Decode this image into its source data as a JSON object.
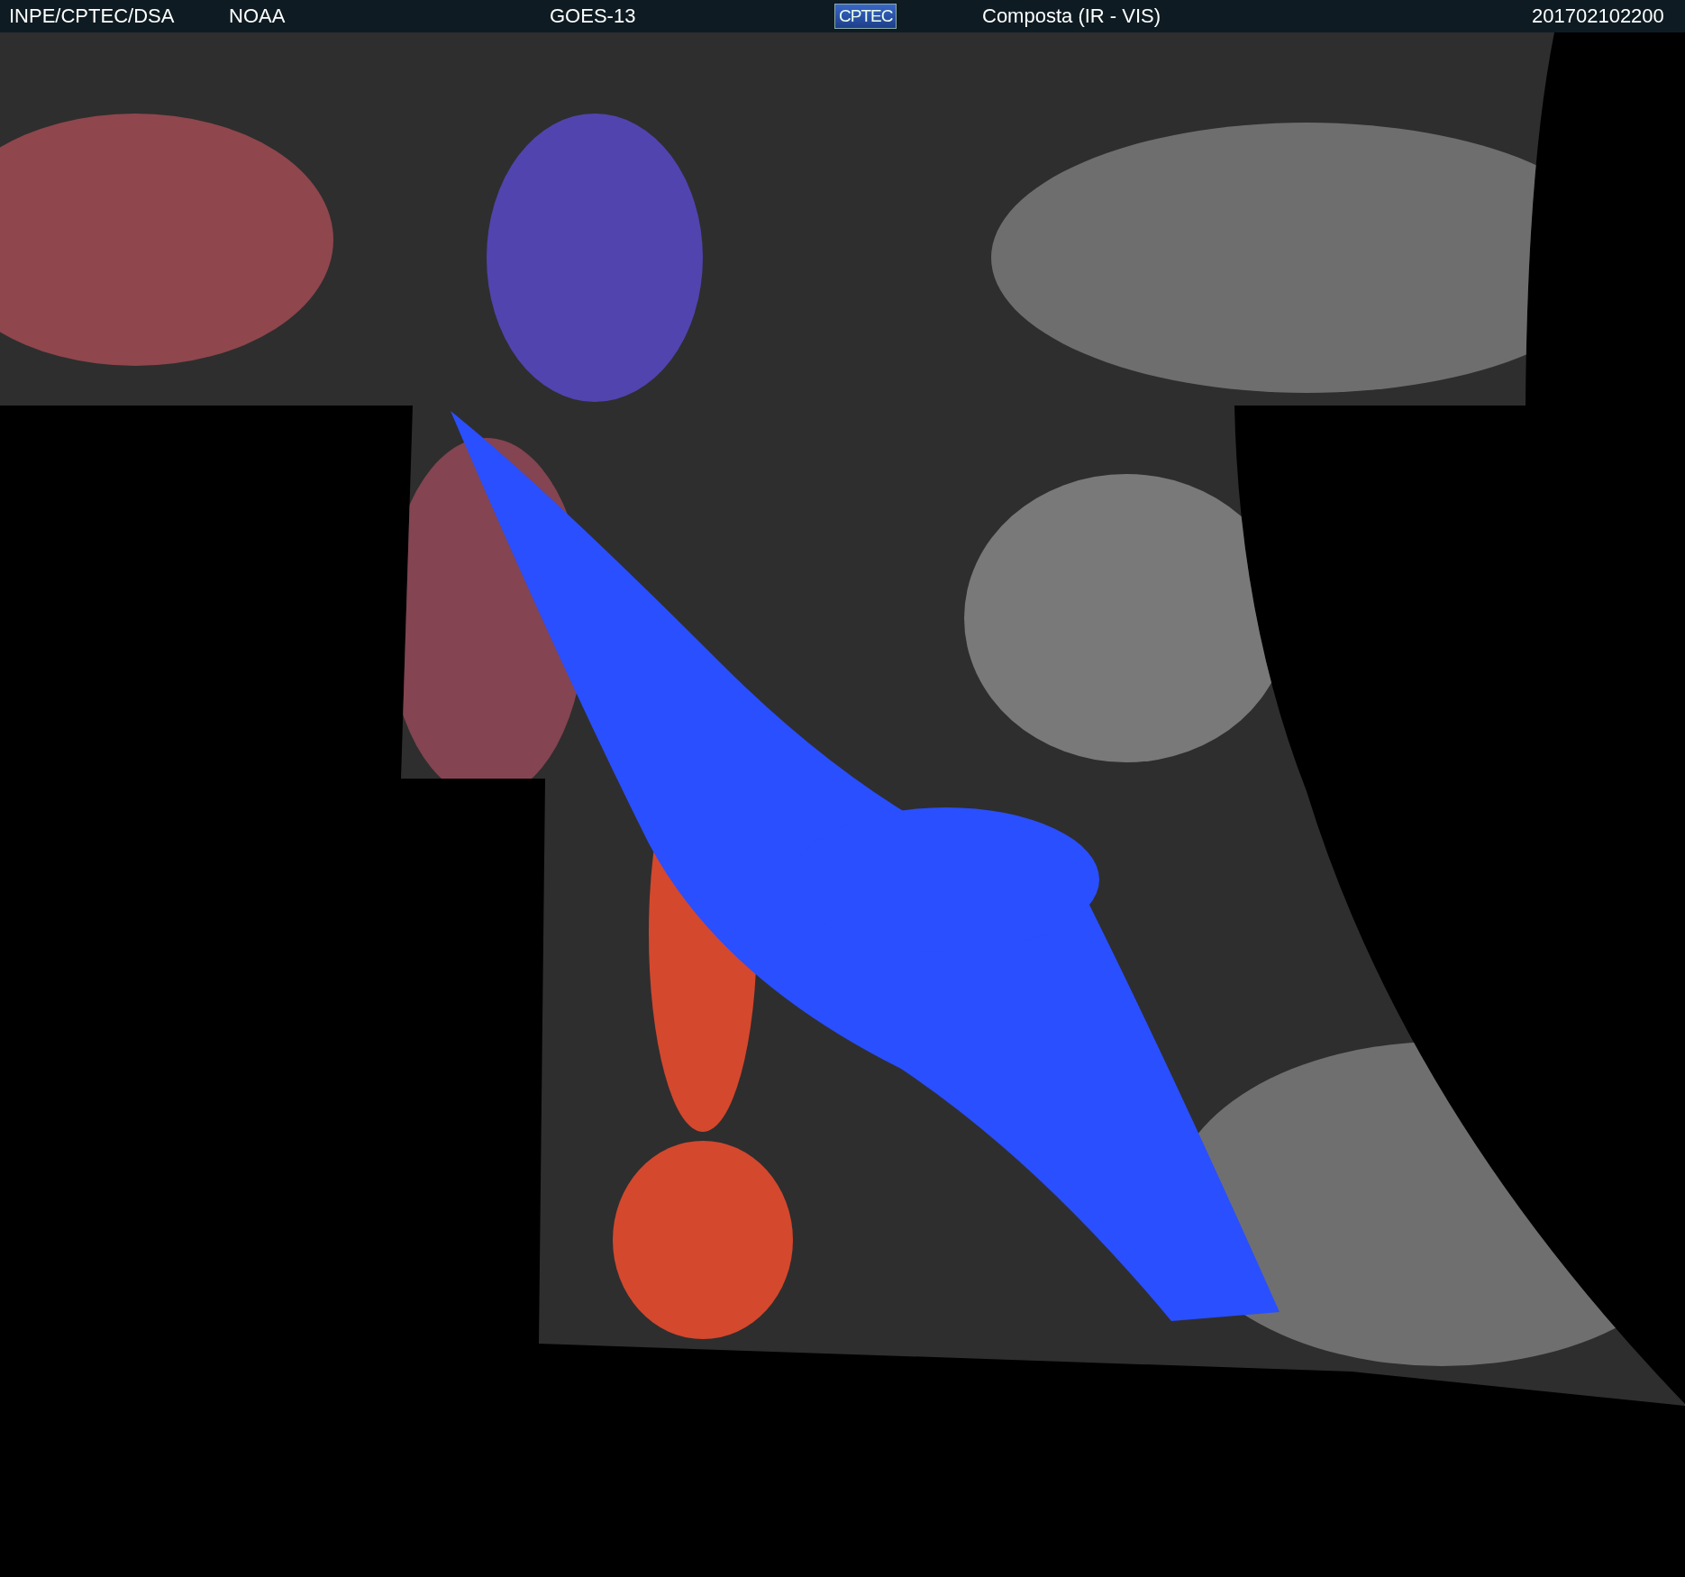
{
  "header": {
    "items": [
      {
        "kind": "text",
        "text": "INPE/CPTEC/DSA"
      },
      {
        "kind": "text",
        "text": "NOAA"
      },
      {
        "kind": "text",
        "text": "GOES-13"
      },
      {
        "kind": "logo",
        "text": "CPTEC"
      },
      {
        "kind": "text",
        "text": "Composta (IR - VIS)"
      },
      {
        "kind": "text",
        "text": "201702102200"
      }
    ]
  }
}
